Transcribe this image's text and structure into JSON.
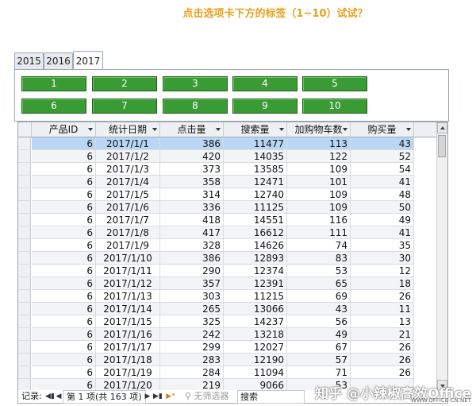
{
  "title": "点击选项卡下方的标签（1~10）试试？",
  "tabs": [
    {
      "label": "2015",
      "active": false
    },
    {
      "label": "2016",
      "active": false
    },
    {
      "label": "2017",
      "active": true
    }
  ],
  "buttons": [
    "1",
    "2",
    "3",
    "4",
    "5",
    "6",
    "7",
    "8",
    "9",
    "10"
  ],
  "columns": [
    "产品ID",
    "统计日期",
    "点击量",
    "搜索量",
    "加购物车数",
    "购买量"
  ],
  "rows": [
    {
      "id": "6",
      "date": "2017/1/1",
      "clicks": "386",
      "search": "11477",
      "cart": "113",
      "buy": "43"
    },
    {
      "id": "6",
      "date": "2017/1/2",
      "clicks": "420",
      "search": "14035",
      "cart": "122",
      "buy": "52"
    },
    {
      "id": "6",
      "date": "2017/1/3",
      "clicks": "373",
      "search": "13585",
      "cart": "109",
      "buy": "54"
    },
    {
      "id": "6",
      "date": "2017/1/4",
      "clicks": "358",
      "search": "12471",
      "cart": "101",
      "buy": "41"
    },
    {
      "id": "6",
      "date": "2017/1/5",
      "clicks": "314",
      "search": "12740",
      "cart": "109",
      "buy": "48"
    },
    {
      "id": "6",
      "date": "2017/1/6",
      "clicks": "336",
      "search": "11125",
      "cart": "109",
      "buy": "50"
    },
    {
      "id": "6",
      "date": "2017/1/7",
      "clicks": "418",
      "search": "14551",
      "cart": "116",
      "buy": "49"
    },
    {
      "id": "6",
      "date": "2017/1/8",
      "clicks": "417",
      "search": "16612",
      "cart": "111",
      "buy": "41"
    },
    {
      "id": "6",
      "date": "2017/1/9",
      "clicks": "328",
      "search": "14626",
      "cart": "74",
      "buy": "35"
    },
    {
      "id": "6",
      "date": "2017/1/10",
      "clicks": "386",
      "search": "12893",
      "cart": "83",
      "buy": "30"
    },
    {
      "id": "6",
      "date": "2017/1/11",
      "clicks": "290",
      "search": "12374",
      "cart": "53",
      "buy": "12"
    },
    {
      "id": "6",
      "date": "2017/1/12",
      "clicks": "357",
      "search": "12391",
      "cart": "65",
      "buy": "18"
    },
    {
      "id": "6",
      "date": "2017/1/13",
      "clicks": "303",
      "search": "11215",
      "cart": "69",
      "buy": "26"
    },
    {
      "id": "6",
      "date": "2017/1/14",
      "clicks": "265",
      "search": "13066",
      "cart": "43",
      "buy": "11"
    },
    {
      "id": "6",
      "date": "2017/1/15",
      "clicks": "325",
      "search": "14237",
      "cart": "56",
      "buy": "13"
    },
    {
      "id": "6",
      "date": "2017/1/16",
      "clicks": "242",
      "search": "13218",
      "cart": "49",
      "buy": "21"
    },
    {
      "id": "6",
      "date": "2017/1/17",
      "clicks": "299",
      "search": "12027",
      "cart": "67",
      "buy": "26"
    },
    {
      "id": "6",
      "date": "2017/1/18",
      "clicks": "283",
      "search": "12190",
      "cart": "57",
      "buy": "26"
    },
    {
      "id": "6",
      "date": "2017/1/19",
      "clicks": "284",
      "search": "11094",
      "cart": "71",
      "buy": "26"
    },
    {
      "id": "6",
      "date": "2017/1/20",
      "clicks": "219",
      "search": "9066",
      "cart": "53",
      "buy": ""
    }
  ],
  "nav": {
    "record_label": "记录:",
    "first_icon": "first-record-icon",
    "prev_icon": "prev-record-icon",
    "page_info": "第 1 项(共 163 项)",
    "next_icon": "next-record-icon",
    "last_icon": "last-record-icon",
    "new_icon": "new-record-icon",
    "filter_label": "无筛选器",
    "search_label": "搜索"
  },
  "watermark": "知乎 @小辣椒高效Office",
  "watermark_sub": "WWW.OFFICE-CN.NET",
  "colors": {
    "title": "#e8a020",
    "button": "#3a9a33",
    "selected_row": "#b9d7f5"
  }
}
